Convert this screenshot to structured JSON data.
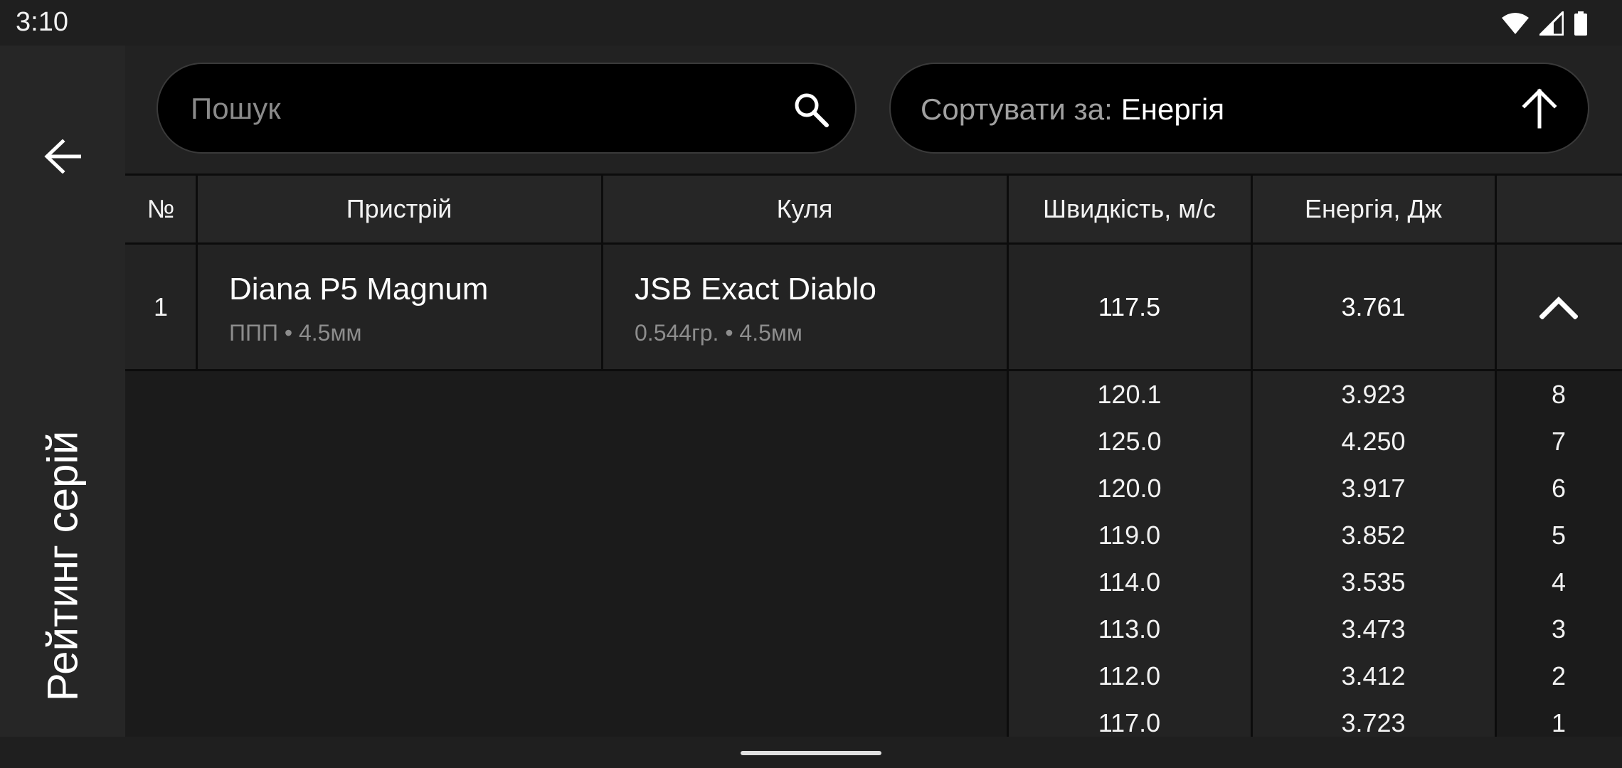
{
  "status_bar": {
    "time": "3:10",
    "icons": [
      "wifi-icon",
      "cell-signal-icon",
      "battery-icon"
    ]
  },
  "side_rail": {
    "back_icon": "arrow-back-icon",
    "title": "Рейтинг серій"
  },
  "search": {
    "placeholder": "Пошук",
    "value": "",
    "icon": "search-icon"
  },
  "sort": {
    "label": "Сортувати за:",
    "value": "Енергія",
    "direction_icon": "arrow-up-icon"
  },
  "table": {
    "headers": {
      "number": "№",
      "device": "Пристрій",
      "bullet": "Куля",
      "velocity": "Швидкість, м/с",
      "energy": "Енергія, Дж",
      "extra": ""
    },
    "rows": [
      {
        "number": "1",
        "device_name": "Diana P5 Magnum",
        "device_info": "ППП • 4.5мм",
        "bullet_name": "JSB Exact Diablo",
        "bullet_info": "0.544гр. • 4.5мм",
        "velocity": "117.5",
        "energy": "3.761",
        "expanded": true,
        "toggle_icon": "chevron-up-icon",
        "shots": [
          {
            "velocity": "120.1",
            "energy": "3.923",
            "index": "8"
          },
          {
            "velocity": "125.0",
            "energy": "4.250",
            "index": "7"
          },
          {
            "velocity": "120.0",
            "energy": "3.917",
            "index": "6"
          },
          {
            "velocity": "119.0",
            "energy": "3.852",
            "index": "5"
          },
          {
            "velocity": "114.0",
            "energy": "3.535",
            "index": "4"
          },
          {
            "velocity": "113.0",
            "energy": "3.473",
            "index": "3"
          },
          {
            "velocity": "112.0",
            "energy": "3.412",
            "index": "2"
          },
          {
            "velocity": "117.0",
            "energy": "3.723",
            "index": "1"
          }
        ]
      }
    ]
  },
  "colors": {
    "background": "#1b1b1b",
    "panel": "#262626",
    "pill": "#000000",
    "text_primary": "#ffffff",
    "text_secondary": "#8d8d8d"
  }
}
